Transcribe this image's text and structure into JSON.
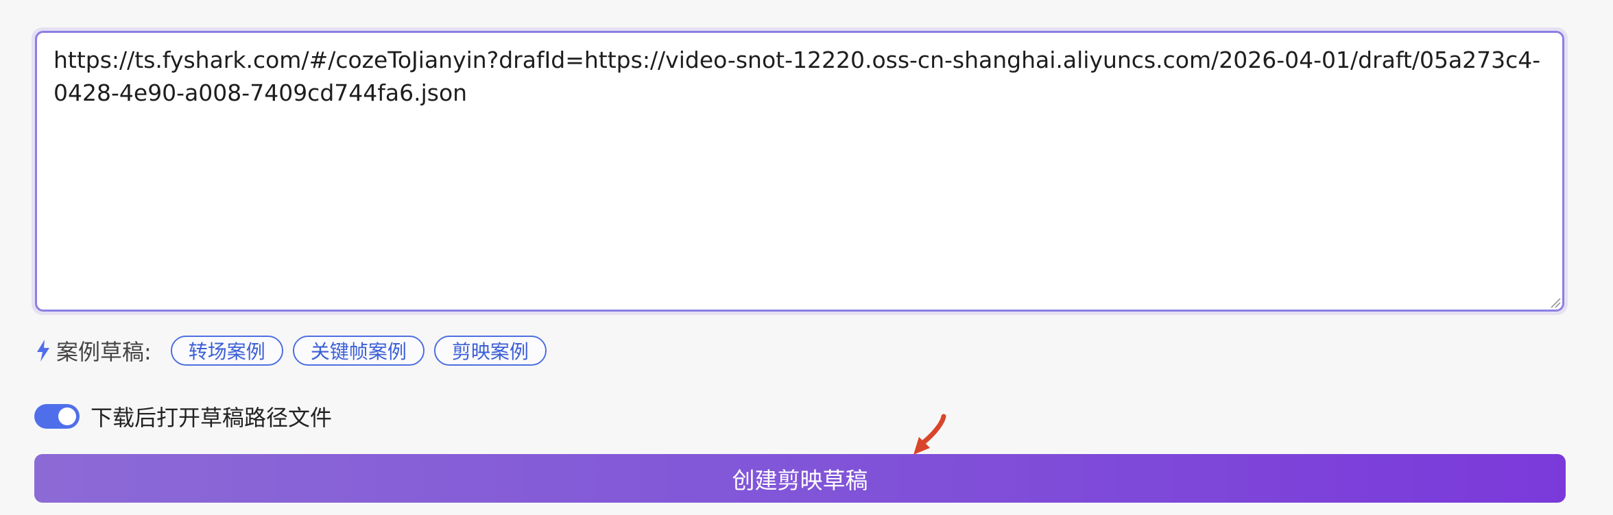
{
  "textarea": {
    "value": "https://ts.fyshark.com/#/cozeToJianyin?drafId=https://video-snot-12220.oss-cn-shanghai.aliyuncs.com/2026-04-01/draft/05a273c4-0428-4e90-a008-7409cd744fa6.json"
  },
  "samples": {
    "label": "案例草稿:",
    "chips": [
      "转场案例",
      "关键帧案例",
      "剪映案例"
    ]
  },
  "toggle": {
    "label": "下载后打开草稿路径文件",
    "checked": true
  },
  "create_button": {
    "label": "创建剪映草稿"
  },
  "colors": {
    "accent": "#4f6fea",
    "button_gradient_start": "#8c6ad6",
    "button_gradient_end": "#7b39da",
    "arrow": "#d9452b"
  },
  "icons": {
    "bolt": "bolt-icon",
    "arrow": "annotation-arrow-icon",
    "resize": "resize-grip-icon"
  }
}
